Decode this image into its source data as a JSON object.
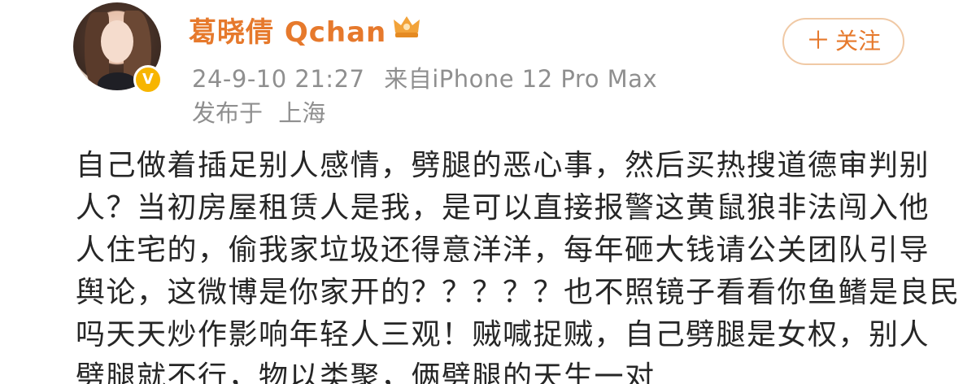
{
  "user": {
    "name": "葛晓倩 Qchan",
    "verified": true
  },
  "post_meta": {
    "time": "24-9-10 21:27",
    "source": "来自iPhone 12 Pro Max",
    "location_label": "发布于",
    "location": "上海"
  },
  "follow_button": {
    "label": "关注"
  },
  "post": {
    "lines": [
      "自己做着插足别人感情，劈腿的恶心事，然后买热搜道德审判别",
      "人？当初房屋租赁人是我，是可以直接报警这黄鼠狼非法闯入他",
      "人住宅的，偷我家垃圾还得意洋洋，每年砸大钱请公关团队引导",
      "舆论，这微博是你家开的？？？？？也不照镜子看看你鱼鳍是良民",
      "吗天天炒作影响年轻人三观！贼喊捉贼，自己劈腿是女权，别人",
      "劈腿就不行，物以类聚，俩劈腿的天生一对"
    ]
  },
  "colors": {
    "name": "#e6792c",
    "meta": "#8f8f8f",
    "body_text": "#262626",
    "follow_border": "#f0c9a5",
    "verify_badge": "#f7b500"
  }
}
